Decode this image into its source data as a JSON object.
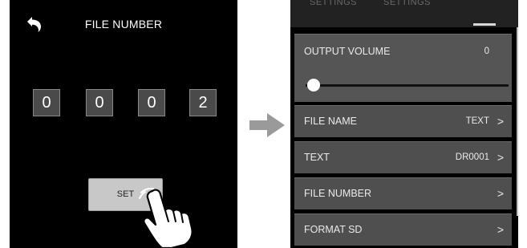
{
  "left_screen": {
    "title": "FILE NUMBER",
    "digits": [
      "0",
      "0",
      "0",
      "2"
    ],
    "set_label": "SET",
    "icons": {
      "back": "back-arrow-icon",
      "hand": "pointing-hand-icon"
    }
  },
  "arrow": {
    "icon": "right-arrow-icon",
    "color": "#9a9a9a"
  },
  "right_screen": {
    "tabs": [
      "SETTINGS",
      "SETTINGS"
    ],
    "output_volume": {
      "label": "OUTPUT VOLUME",
      "value": "0",
      "level": 0
    },
    "items": [
      {
        "label": "FILE NAME",
        "value": "TEXT",
        "chevron": ">"
      },
      {
        "label": "TEXT",
        "value": "DR0001",
        "chevron": ">"
      },
      {
        "label": "FILE NUMBER",
        "value": "",
        "chevron": ">"
      },
      {
        "label": "FORMAT SD",
        "value": "",
        "chevron": ">"
      }
    ]
  }
}
